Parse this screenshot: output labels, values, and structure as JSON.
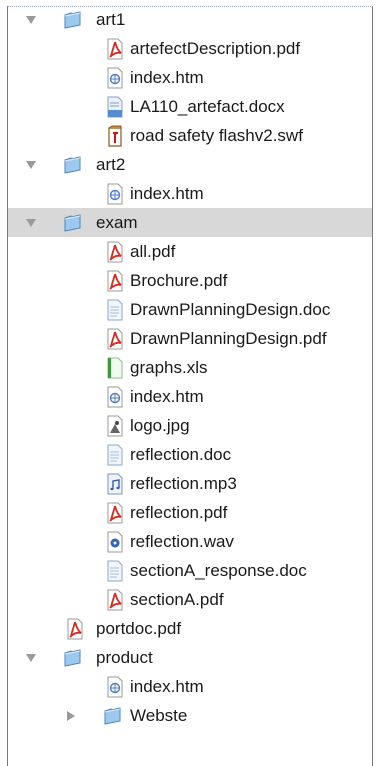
{
  "tree": [
    {
      "label": "art1",
      "icon": "folder-icon",
      "level": 0,
      "disclosure": "open",
      "selected": false
    },
    {
      "label": "artefectDescription.pdf",
      "icon": "pdf-file-icon",
      "level": 1
    },
    {
      "label": "index.htm",
      "icon": "html-file-icon",
      "level": 1
    },
    {
      "label": "LA110_artefact.docx",
      "icon": "docx-file-icon",
      "level": 1
    },
    {
      "label": "road safety flashv2.swf",
      "icon": "swf-file-icon",
      "level": 1
    },
    {
      "label": "art2",
      "icon": "folder-icon",
      "level": 0,
      "disclosure": "open",
      "selected": false
    },
    {
      "label": "index.htm",
      "icon": "html-file-icon",
      "level": 1
    },
    {
      "label": "exam",
      "icon": "folder-icon",
      "level": 0,
      "disclosure": "open",
      "selected": true
    },
    {
      "label": "all.pdf",
      "icon": "pdf-file-icon",
      "level": 1
    },
    {
      "label": "Brochure.pdf",
      "icon": "pdf-file-icon",
      "level": 1
    },
    {
      "label": "DrawnPlanningDesign.doc",
      "icon": "doc-file-icon",
      "level": 1
    },
    {
      "label": "DrawnPlanningDesign.pdf",
      "icon": "pdf-file-icon",
      "level": 1
    },
    {
      "label": "graphs.xls",
      "icon": "xls-file-icon",
      "level": 1
    },
    {
      "label": "index.htm",
      "icon": "html-file-icon",
      "level": 1
    },
    {
      "label": "logo.jpg",
      "icon": "image-file-icon",
      "level": 1
    },
    {
      "label": "reflection.doc",
      "icon": "doc-file-icon",
      "level": 1
    },
    {
      "label": "reflection.mp3",
      "icon": "audio-file-icon",
      "level": 1
    },
    {
      "label": "reflection.pdf",
      "icon": "pdf-file-icon",
      "level": 1
    },
    {
      "label": "reflection.wav",
      "icon": "wav-file-icon",
      "level": 1
    },
    {
      "label": "sectionA_response.doc",
      "icon": "doc-file-icon",
      "level": 1
    },
    {
      "label": "sectionA.pdf",
      "icon": "pdf-file-icon",
      "level": 1
    },
    {
      "label": "portdoc.pdf",
      "icon": "pdf-file-icon",
      "level": 0
    },
    {
      "label": "product",
      "icon": "folder-icon",
      "level": 0,
      "disclosure": "open",
      "selected": false
    },
    {
      "label": "index.htm",
      "icon": "html-file-icon",
      "level": 1
    },
    {
      "label": "Webste",
      "icon": "folder-icon",
      "level": 1,
      "disclosure": "closed",
      "selected": false
    }
  ],
  "colors": {
    "selected_row": "#d8d8d8",
    "folder": "#9cc9ee",
    "pdf_red": "#d42a1f",
    "doc_blue": "#5a8ad0",
    "xls_green": "#3c9a3c"
  }
}
